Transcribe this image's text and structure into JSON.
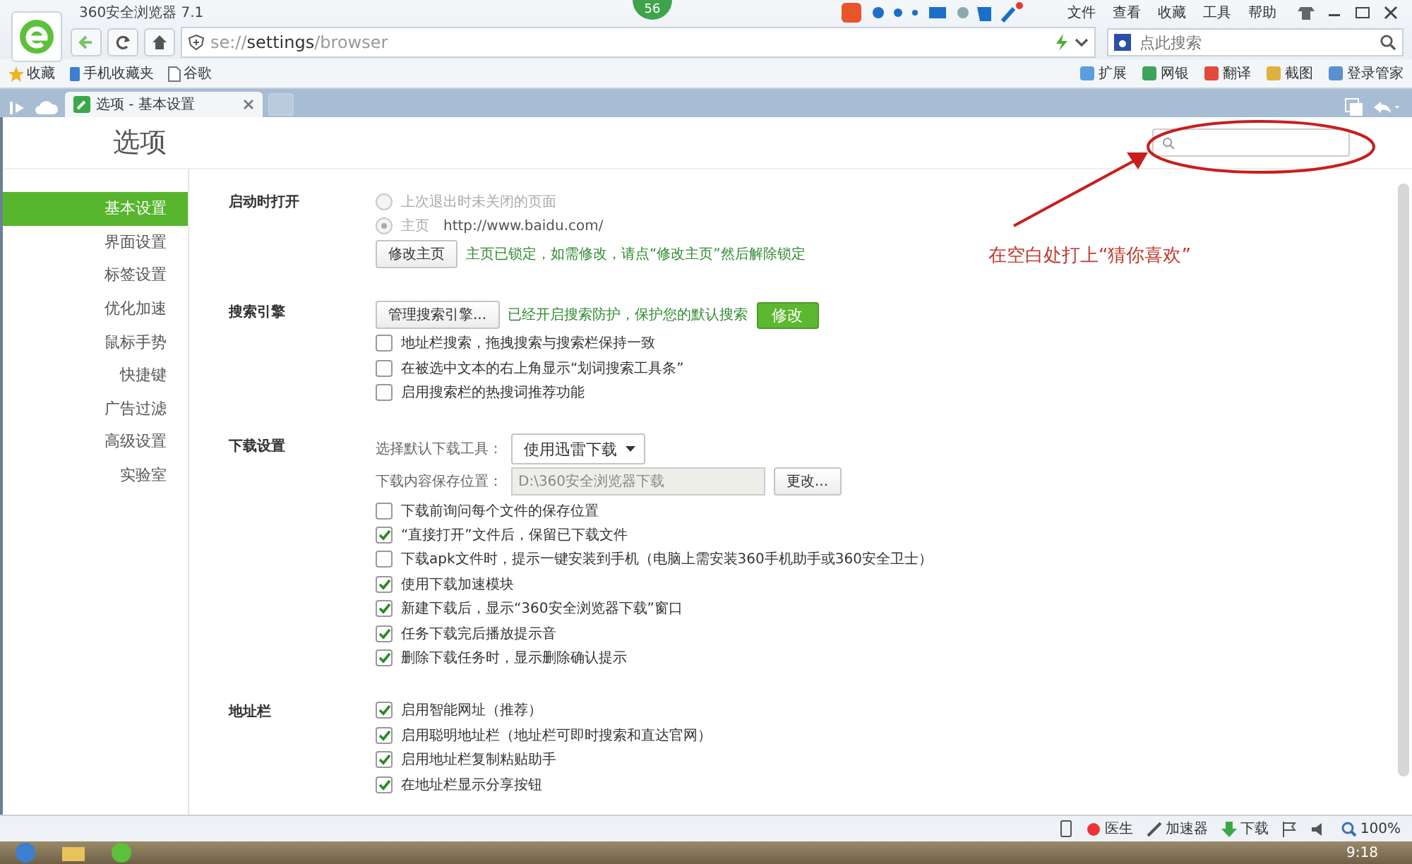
{
  "window": {
    "title": "360安全浏览器 7.1",
    "badge": "56"
  },
  "menu": [
    "文件",
    "查看",
    "收藏",
    "工具",
    "帮助"
  ],
  "address_bar": {
    "value": "se://**settings**/browser"
  },
  "search_box": {
    "placeholder": "点此搜索"
  },
  "bookmarks": [
    "收藏",
    "手机收藏夹",
    "谷歌"
  ],
  "extensions": [
    "扩展",
    "网银",
    "翻译",
    "截图",
    "登录管家"
  ],
  "tabs": [
    {
      "label": "选项 - 基本设置",
      "selected": true
    }
  ],
  "page_title": "选项",
  "sidebar": [
    {
      "label": "基本设置",
      "selected": true
    },
    {
      "label": "界面设置",
      "selected": false
    },
    {
      "label": "标签设置",
      "selected": false
    },
    {
      "label": "优化加速",
      "selected": false
    },
    {
      "label": "鼠标手势",
      "selected": false
    },
    {
      "label": "快捷键",
      "selected": false
    },
    {
      "label": "广告过滤",
      "selected": false
    },
    {
      "label": "高级设置",
      "selected": false
    },
    {
      "label": "实验室",
      "selected": false
    }
  ],
  "sections": [
    {
      "title": "启动时打开",
      "rows": [
        {
          "kind": "radio",
          "label": "上次退出时未关闭的页面",
          "selected": false,
          "disabled": true
        },
        {
          "kind": "radio",
          "label": "主页",
          "value": "http://www.baidu.com/",
          "selected": true,
          "disabled": true
        },
        {
          "kind": "button",
          "button": "修改主页",
          "note": "主页已锁定，如需修改，请点“修改主页”然后解除锁定"
        }
      ]
    },
    {
      "title": "搜索引擎",
      "rows": [
        {
          "kind": "button",
          "button": "管理搜索引擎...",
          "note": "已经开启搜索防护，保护您的默认搜索",
          "action": "修改"
        },
        {
          "kind": "checkbox",
          "label": "地址栏搜索，拖拽搜索与搜索栏保持一致",
          "checked": false
        },
        {
          "kind": "checkbox",
          "label": "在被选中文本的右上角显示“划词搜索工具条”",
          "checked": false
        },
        {
          "kind": "checkbox",
          "label": "启用搜索栏的热搜词推荐功能",
          "checked": false
        }
      ]
    },
    {
      "title": "下载设置",
      "rows": [
        {
          "kind": "select",
          "label": "选择默认下载工具：",
          "value": "使用迅雷下载"
        },
        {
          "kind": "path",
          "label": "下载内容保存位置：",
          "value": "D:\\360安全浏览器下载",
          "button": "更改..."
        },
        {
          "kind": "checkbox",
          "label": "下载前询问每个文件的保存位置",
          "checked": false
        },
        {
          "kind": "checkbox",
          "label": "“直接打开”文件后，保留已下载文件",
          "checked": true
        },
        {
          "kind": "checkbox",
          "label": "下载apk文件时，提示一键安装到手机（电脑上需安装360手机助手或360安全卫士）",
          "checked": false
        },
        {
          "kind": "checkbox",
          "label": "使用下载加速模块",
          "checked": true
        },
        {
          "kind": "checkbox",
          "label": "新建下载后，显示“360安全浏览器下载”窗口",
          "checked": true
        },
        {
          "kind": "checkbox",
          "label": "任务下载完后播放提示音",
          "checked": true
        },
        {
          "kind": "checkbox",
          "label": "删除下载任务时，显示删除确认提示",
          "checked": true
        }
      ]
    },
    {
      "title": "地址栏",
      "rows": [
        {
          "kind": "checkbox",
          "label": "启用智能网址（推荐）",
          "checked": true
        },
        {
          "kind": "checkbox",
          "label": "启用聪明地址栏（地址栏可即时搜索和直达官网）",
          "checked": true
        },
        {
          "kind": "checkbox",
          "label": "启用地址栏复制粘贴助手",
          "checked": true
        },
        {
          "kind": "checkbox",
          "label": "在地址栏显示分享按钮",
          "checked": true
        }
      ]
    }
  ],
  "annotation": {
    "text": "在空白处打上“猜你喜欢”"
  },
  "status_bar": {
    "items": [
      "医生",
      "加速器",
      "下载"
    ],
    "zoom": "100%"
  },
  "taskbar": {
    "time": "9:18"
  }
}
